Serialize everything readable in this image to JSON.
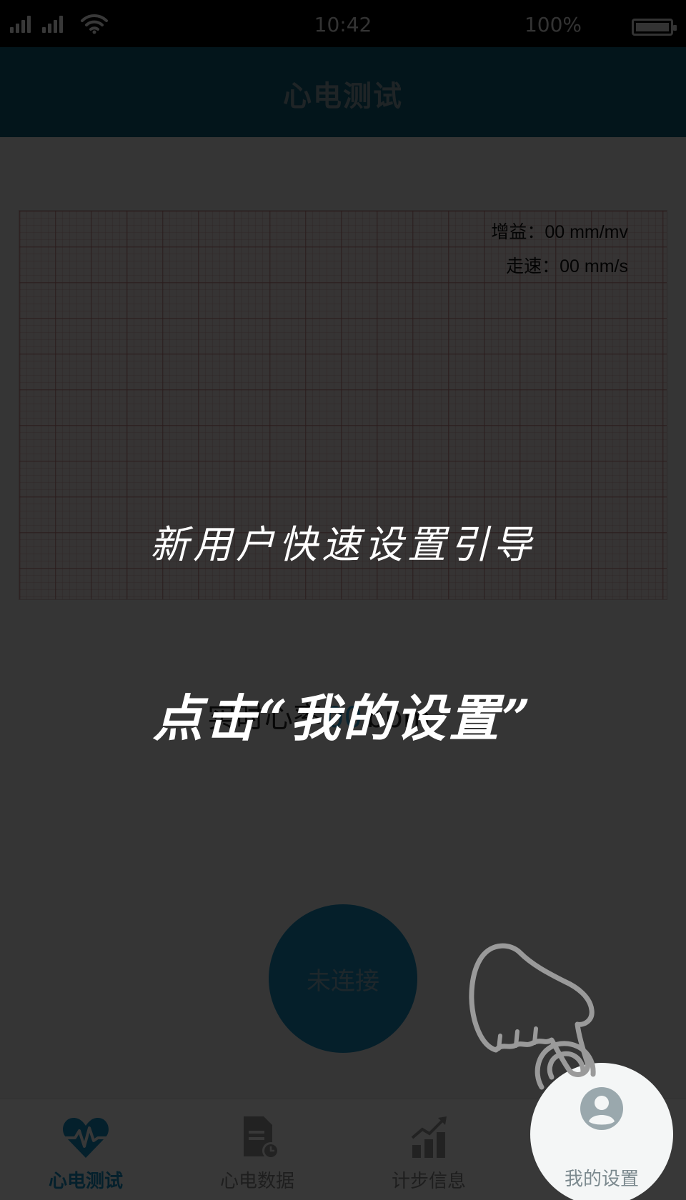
{
  "status_bar": {
    "time": "10:42",
    "battery": "100%"
  },
  "header": {
    "title": "心电测试"
  },
  "ecg": {
    "gain_label": "增益：00 mm/mv",
    "speed_label": "走速：00 mm/s"
  },
  "heart_rate": {
    "prefix": "实时心率",
    "value": "00",
    "unit": "bpm"
  },
  "connect_button": {
    "label": "未连接"
  },
  "nav": {
    "items": [
      {
        "label": "心电测试",
        "icon": "heart-pulse-icon",
        "active": true
      },
      {
        "label": "心电数据",
        "icon": "document-clock-icon",
        "active": false
      },
      {
        "label": "计步信息",
        "icon": "bar-chart-trend-icon",
        "active": false
      },
      {
        "label": "我的设置",
        "icon": "user-circle-icon",
        "active": false
      }
    ]
  },
  "guide": {
    "title": "新用户快速设置引导",
    "instruction": "点击“我的设置”"
  },
  "colors": {
    "accent": "#1592c9",
    "header": "#0e5f7c",
    "overlay": "rgba(0,0,0,0.78)"
  }
}
